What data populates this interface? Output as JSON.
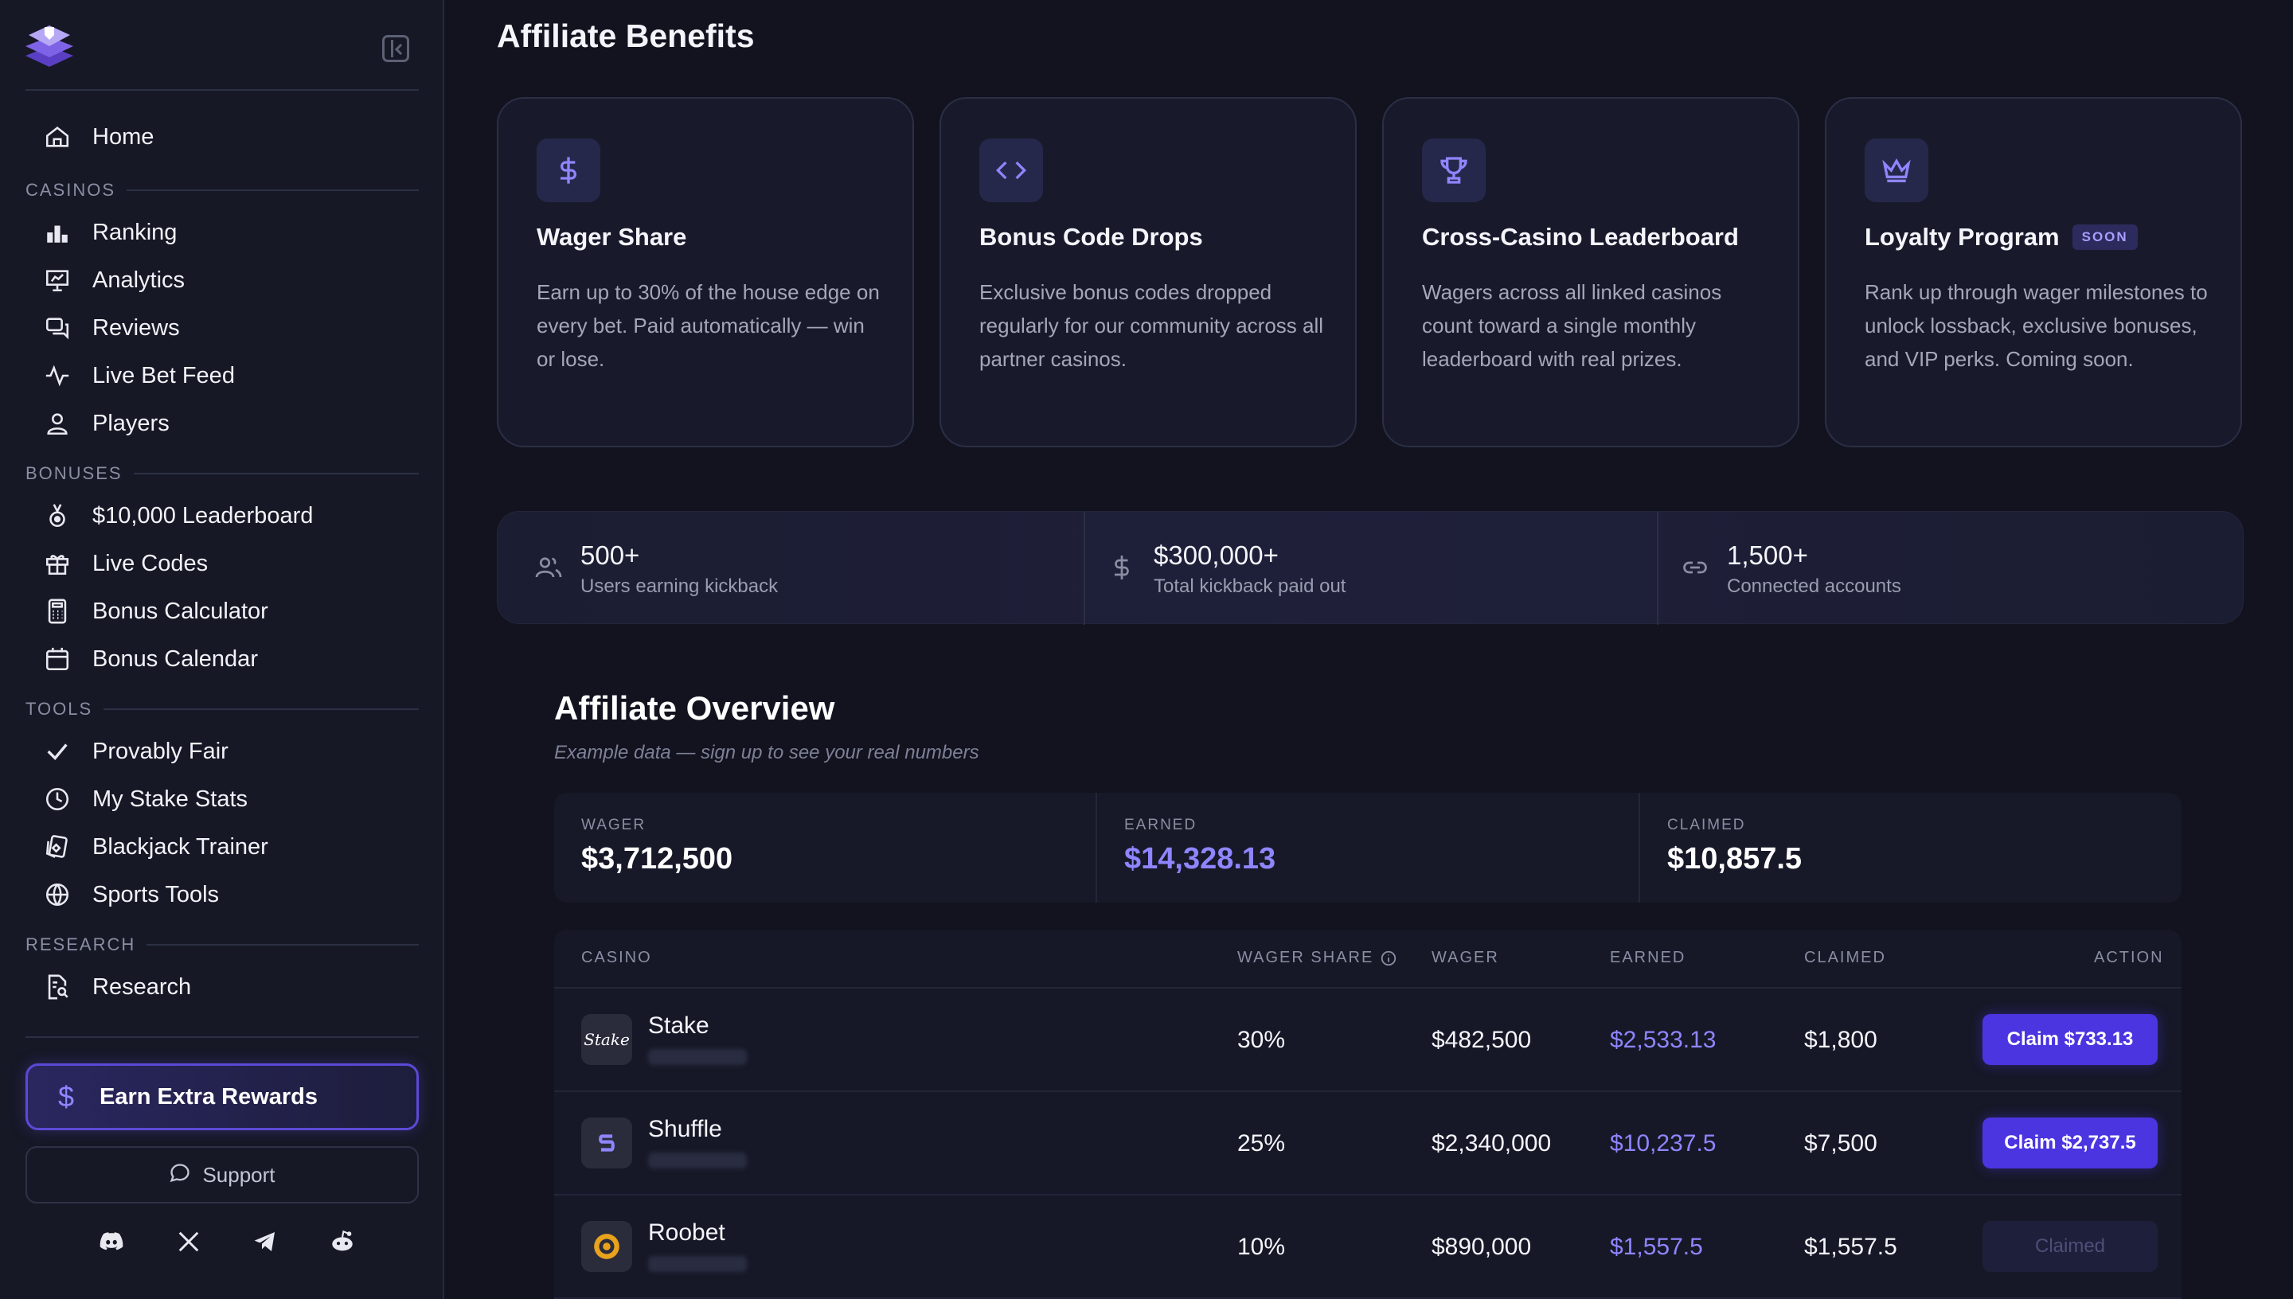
{
  "sidebar": {
    "home": "Home",
    "sections": [
      {
        "title": "CASINOS",
        "items": [
          "Ranking",
          "Analytics",
          "Reviews",
          "Live Bet Feed",
          "Players"
        ]
      },
      {
        "title": "BONUSES",
        "items": [
          "$10,000 Leaderboard",
          "Live Codes",
          "Bonus Calculator",
          "Bonus Calendar"
        ]
      },
      {
        "title": "TOOLS",
        "items": [
          "Provably Fair",
          "My Stake Stats",
          "Blackjack Trainer",
          "Sports Tools"
        ]
      },
      {
        "title": "RESEARCH",
        "items": [
          "Research"
        ]
      }
    ],
    "earn_label": "Earn Extra Rewards",
    "support_label": "Support",
    "socials": [
      "discord-icon",
      "x-icon",
      "telegram-icon",
      "reddit-icon"
    ]
  },
  "benefits": {
    "title": "Affiliate Benefits",
    "cards": [
      {
        "icon": "dollar-icon",
        "title": "Wager Share",
        "desc": "Earn up to 30% of the house edge on every bet. Paid automatically — win or lose."
      },
      {
        "icon": "code-icon",
        "title": "Bonus Code Drops",
        "desc": "Exclusive bonus codes dropped regularly for our community across all partner casinos."
      },
      {
        "icon": "trophy-icon",
        "title": "Cross-Casino Leaderboard",
        "desc": "Wagers across all linked casinos count toward a single monthly leaderboard with real prizes."
      },
      {
        "icon": "crown-icon",
        "title": "Loyalty Program",
        "badge": "SOON",
        "desc": "Rank up through wager milestones to unlock lossback, exclusive bonuses, and VIP perks. Coming soon."
      }
    ]
  },
  "stats": [
    {
      "value": "500+",
      "label": "Users earning kickback"
    },
    {
      "value": "$300,000+",
      "label": "Total kickback paid out"
    },
    {
      "value": "1,500+",
      "label": "Connected accounts"
    }
  ],
  "overview": {
    "title": "Affiliate Overview",
    "subtitle": "Example data — sign up to see your real numbers",
    "summary": [
      {
        "key": "WAGER",
        "value": "$3,712,500"
      },
      {
        "key": "EARNED",
        "value": "$14,328.13"
      },
      {
        "key": "CLAIMED",
        "value": "$10,857.5"
      }
    ],
    "columns": [
      "CASINO",
      "WAGER SHARE",
      "WAGER",
      "EARNED",
      "CLAIMED",
      "ACTION"
    ],
    "rows": [
      {
        "casino": "Stake",
        "share": "30%",
        "wager": "$482,500",
        "earned": "$2,533.13",
        "claimed": "$1,800",
        "action": "Claim $733.13"
      },
      {
        "casino": "Shuffle",
        "share": "25%",
        "wager": "$2,340,000",
        "earned": "$10,237.5",
        "claimed": "$7,500",
        "action": "Claim $2,737.5"
      },
      {
        "casino": "Roobet",
        "share": "10%",
        "wager": "$890,000",
        "earned": "$1,557.5",
        "claimed": "$1,557.5",
        "action": "Claimed"
      }
    ],
    "colors": {
      "accent": "#8f85ff",
      "button": "#4b35e0"
    }
  }
}
